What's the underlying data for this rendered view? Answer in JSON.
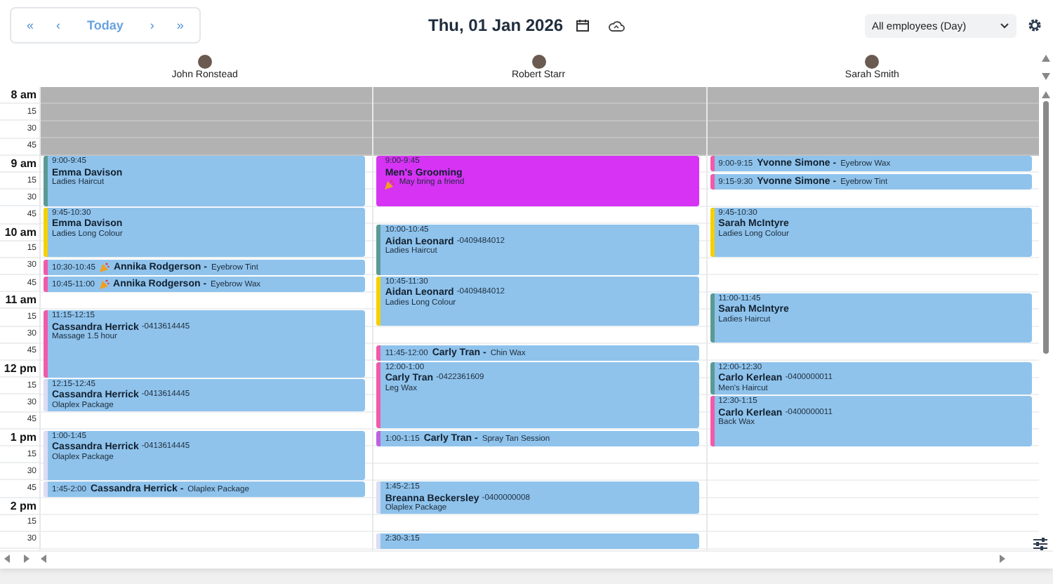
{
  "toolbar": {
    "nav": [
      {
        "kind": "first",
        "label": "«"
      },
      {
        "kind": "prev",
        "label": "‹"
      },
      {
        "kind": "today",
        "label": "Today"
      },
      {
        "kind": "next",
        "label": "›"
      },
      {
        "kind": "last",
        "label": "»"
      }
    ],
    "date": "Thu, 01 Jan 2026",
    "view_select": "All employees (Day)"
  },
  "time_labels": [
    {
      "kind": "hour",
      "label": "8 am"
    },
    {
      "kind": "minute",
      "label": "15"
    },
    {
      "kind": "minute",
      "label": "30"
    },
    {
      "kind": "minute",
      "label": "45"
    },
    {
      "kind": "hour",
      "label": "9 am"
    },
    {
      "kind": "minute",
      "label": "15"
    },
    {
      "kind": "minute",
      "label": "30"
    },
    {
      "kind": "minute",
      "label": "45"
    },
    {
      "kind": "hour",
      "label": "10 am"
    },
    {
      "kind": "minute",
      "label": "15"
    },
    {
      "kind": "minute",
      "label": "30"
    },
    {
      "kind": "minute",
      "label": "45"
    },
    {
      "kind": "hour",
      "label": "11 am"
    },
    {
      "kind": "minute",
      "label": "15"
    },
    {
      "kind": "minute",
      "label": "30"
    },
    {
      "kind": "minute",
      "label": "45"
    },
    {
      "kind": "hour",
      "label": "12 pm"
    },
    {
      "kind": "minute",
      "label": "15"
    },
    {
      "kind": "minute",
      "label": "30"
    },
    {
      "kind": "minute",
      "label": "45"
    },
    {
      "kind": "hour",
      "label": "1 pm"
    },
    {
      "kind": "minute",
      "label": "15"
    },
    {
      "kind": "minute",
      "label": "30"
    },
    {
      "kind": "minute",
      "label": "45"
    },
    {
      "kind": "hour",
      "label": "2 pm"
    },
    {
      "kind": "minute",
      "label": "15"
    },
    {
      "kind": "minute",
      "label": "30"
    }
  ],
  "employees": [
    {
      "name": "John Ronstead",
      "events": [
        {
          "kind": "full",
          "time": "9:00-9:45",
          "name": "Emma Davison",
          "service": "Ladies Haircut",
          "color": "#5a9a94",
          "icon": false
        },
        {
          "kind": "full",
          "time": "9:45-10:30",
          "name": "Emma Davison",
          "service": "Ladies Long Colour",
          "color": "#f5d000",
          "icon": false
        },
        {
          "kind": "compact",
          "time": "10:30-10:45",
          "name": "Annika Rodgerson -",
          "service": "Eyebrow Tint",
          "color": "#f25aa8",
          "icon": true
        },
        {
          "kind": "compact",
          "time": "10:45-11:00",
          "name": "Annika Rodgerson -",
          "service": "Eyebrow Wax",
          "color": "#f25aa8",
          "icon": true
        },
        {
          "kind": "full",
          "time": "11:15-12:15",
          "name": "Cassandra Herrick",
          "phone": "-0413614445",
          "service": "Massage 1.5 hour",
          "color": "#f25aa8",
          "icon": false
        },
        {
          "kind": "full",
          "time": "12:15-12:45",
          "name": "Cassandra Herrick",
          "phone": "-0413614445",
          "service": "Olaplex Package",
          "color": "#dcdcf2",
          "icon": false
        },
        {
          "kind": "full",
          "time": "1:00-1:45",
          "name": "Cassandra Herrick",
          "phone": "-0413614445",
          "service": "Olaplex Package",
          "color": "#dcdcf2",
          "icon": false
        },
        {
          "kind": "compact",
          "time": "1:45-2:00",
          "name": "Cassandra Herrick -",
          "service": "Olaplex Package",
          "color": "#dcdcf2",
          "icon": false
        }
      ]
    },
    {
      "name": "Robert Starr",
      "events": [
        {
          "kind": "block",
          "time": "9:00-9:45",
          "name": "Men's Grooming",
          "service": "May bring a friend",
          "color": "#d633f5",
          "icon": true
        },
        {
          "kind": "full",
          "time": "10:00-10:45",
          "name": "Aidan Leonard",
          "phone": "-0409484012",
          "service": "Ladies Haircut",
          "color": "#5a9a94",
          "icon": false
        },
        {
          "kind": "full",
          "time": "10:45-11:30",
          "name": "Aidan Leonard",
          "phone": "-0409484012",
          "service": "Ladies Long Colour",
          "color": "#f5d000",
          "icon": false
        },
        {
          "kind": "compact",
          "time": "11:45-12:00",
          "name": "Carly Tran -",
          "service": "Chin Wax",
          "color": "#f25aa8",
          "icon": false
        },
        {
          "kind": "full",
          "time": "12:00-1:00",
          "name": "Carly Tran",
          "phone": "-0422361609",
          "service": "Leg Wax",
          "color": "#f25aa8",
          "icon": false
        },
        {
          "kind": "compact",
          "time": "1:00-1:15",
          "name": "Carly Tran -",
          "service": "Spray Tan Session",
          "color": "#c060e0",
          "icon": false
        },
        {
          "kind": "full",
          "time": "1:45-2:15",
          "name": "Breanna Beckersley",
          "phone": "-0400000008",
          "service": "Olaplex Package",
          "color": "#dcdcf2",
          "icon": false
        },
        {
          "kind": "full",
          "time": "2:30-3:15",
          "color": "#dcdcf2",
          "icon": false
        }
      ]
    },
    {
      "name": "Sarah Smith",
      "events": [
        {
          "kind": "compact",
          "time": "9:00-9:15",
          "name": "Yvonne Simone -",
          "service": "Eyebrow Wax",
          "color": "#f25aa8",
          "icon": false
        },
        {
          "kind": "compact",
          "time": "9:15-9:30",
          "name": "Yvonne Simone -",
          "service": "Eyebrow Tint",
          "color": "#f25aa8",
          "icon": false
        },
        {
          "kind": "full",
          "time": "9:45-10:30",
          "name": "Sarah McIntyre",
          "service": "Ladies Long Colour",
          "color": "#f5d000",
          "icon": false
        },
        {
          "kind": "full",
          "time": "11:00-11:45",
          "name": "Sarah McIntyre",
          "service": "Ladies Haircut",
          "color": "#5a9a94",
          "icon": false
        },
        {
          "kind": "full",
          "time": "12:00-12:30",
          "name": "Carlo Kerlean",
          "phone": "-0400000011",
          "service": "Men's Haircut",
          "color": "#5a9a94",
          "icon": false
        },
        {
          "kind": "full",
          "time": "12:30-1:15",
          "name": "Carlo Kerlean",
          "phone": "-0400000011",
          "service": "Back Wax",
          "color": "#f25aa8",
          "icon": false
        }
      ]
    }
  ]
}
